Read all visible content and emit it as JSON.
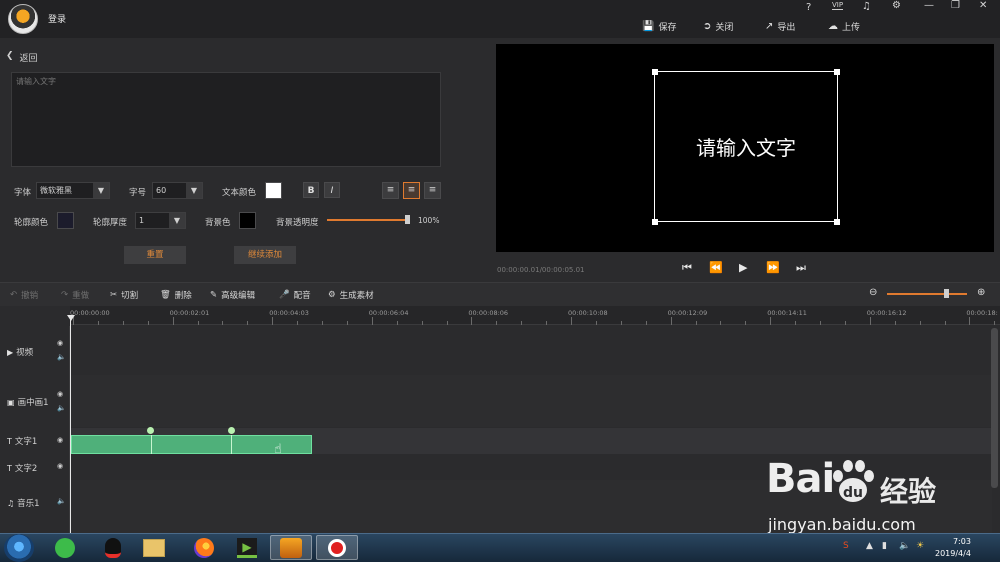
{
  "window": {
    "login_label": "登录",
    "top_icons": {
      "help": "?",
      "vip": "VIP",
      "bell": "bell",
      "settings": "gear",
      "minimize": "—",
      "restore": "❐",
      "close": "✕"
    },
    "actions": [
      {
        "label": "保存",
        "icon": "save-icon"
      },
      {
        "label": "关闭",
        "icon": "close-icon"
      },
      {
        "label": "导出",
        "icon": "export-icon"
      },
      {
        "label": "上传",
        "icon": "upload-icon"
      }
    ]
  },
  "editor": {
    "back_label": "返回",
    "text_placeholder": "请输入文字",
    "font_label": "字体",
    "font_value": "微软雅黑",
    "size_label": "字号",
    "size_value": "60",
    "text_color_label": "文本颜色",
    "bold_label": "B",
    "italic_label": "I",
    "outline_color_label": "轮廓颜色",
    "outline_width_label": "轮廓厚度",
    "outline_width_value": "1",
    "bg_color_label": "背景色",
    "bg_opacity_label": "背景透明度",
    "bg_opacity_value": "100%",
    "reset_label": "重置",
    "continue_label": "继续添加"
  },
  "preview": {
    "text": "请输入文字",
    "timecode": "00:00:00.01/00:00:05.01"
  },
  "toolbar": {
    "undo": "撤销",
    "redo": "重做",
    "cut": "切割",
    "delete": "删除",
    "advanced_edit": "高级编辑",
    "dub": "配音",
    "generate": "生成素材"
  },
  "ruler": {
    "ticks": [
      "00:00:00:00",
      "00:00:02:01",
      "00:00:04:03",
      "00:00:06:04",
      "00:00:08:06",
      "00:00:10:08",
      "00:00:12:09",
      "00:00:14:11",
      "00:00:16:12",
      "00:00:18:"
    ]
  },
  "tracks": [
    {
      "name": "视频",
      "icon": "video-icon"
    },
    {
      "name": "画中画1",
      "icon": "pip-icon"
    },
    {
      "name": "文字1",
      "icon": "text-icon"
    },
    {
      "name": "文字2",
      "icon": "text-icon"
    },
    {
      "name": "音乐1",
      "icon": "music-icon"
    }
  ],
  "watermark": {
    "brand_left": "Bai",
    "brand_right": "经验",
    "url": "jingyan.baidu.com"
  },
  "taskbar": {
    "time": "7:03",
    "date": "2019/4/4"
  },
  "colors": {
    "accent": "#e07a2f",
    "clip": "#4fb07a",
    "preview_bg": "#000000"
  }
}
